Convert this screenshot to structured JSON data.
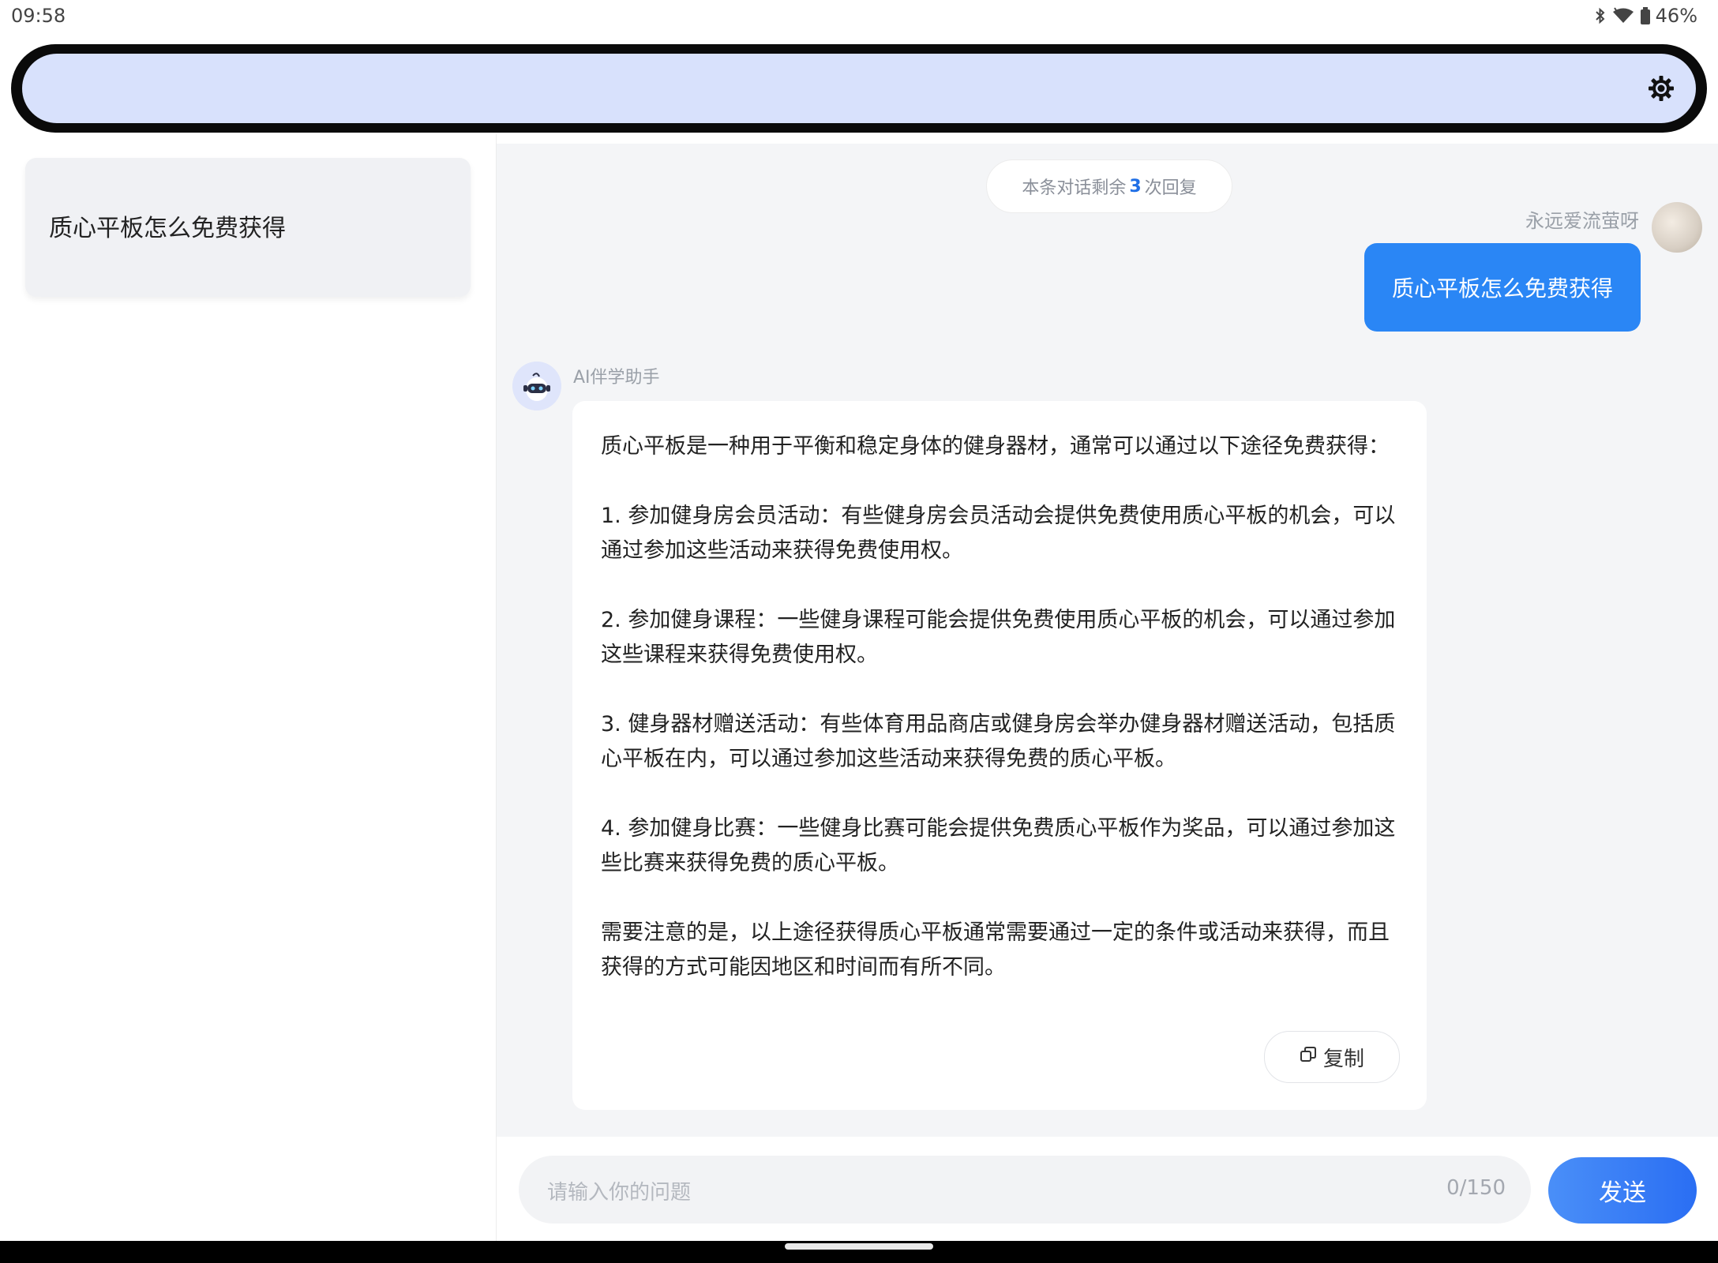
{
  "status_bar": {
    "time": "09:58",
    "battery": "46%",
    "icons": [
      "bluetooth-icon",
      "wifi-icon",
      "battery-icon"
    ]
  },
  "top_bar": {
    "settings_icon": "gear-icon",
    "background_color": "#d8e1fc"
  },
  "sidebar": {
    "history": [
      {
        "title": "质心平板怎么免费获得"
      }
    ]
  },
  "chat": {
    "remaining": {
      "prefix": "本条对话剩余",
      "count": "3",
      "suffix": "次回复"
    },
    "user": {
      "name": "永远爱流萤呀",
      "message": "质心平板怎么免费获得"
    },
    "bot": {
      "name": "AI伴学助手",
      "reply": "质心平板是一种用于平衡和稳定身体的健身器材，通常可以通过以下途径免费获得：\n\n1. 参加健身房会员活动：有些健身房会员活动会提供免费使用质心平板的机会，可以通过参加这些活动来获得免费使用权。\n\n2. 参加健身课程：一些健身课程可能会提供免费使用质心平板的机会，可以通过参加这些课程来获得免费使用权。\n\n3. 健身器材赠送活动：有些体育用品商店或健身房会举办健身器材赠送活动，包括质心平板在内，可以通过参加这些活动来获得免费的质心平板。\n\n4. 参加健身比赛：一些健身比赛可能会提供免费质心平板作为奖品，可以通过参加这些比赛来获得免费的质心平板。\n\n需要注意的是，以上途径获得质心平板通常需要通过一定的条件或活动来获得，而且获得的方式可能因地区和时间而有所不同。",
      "copy_label": "复制"
    }
  },
  "input": {
    "placeholder": "请输入你的问题",
    "counter": "0/150",
    "send_label": "发送"
  },
  "colors": {
    "accent": "#2a86f5",
    "send_button": "#2a6ef3"
  }
}
